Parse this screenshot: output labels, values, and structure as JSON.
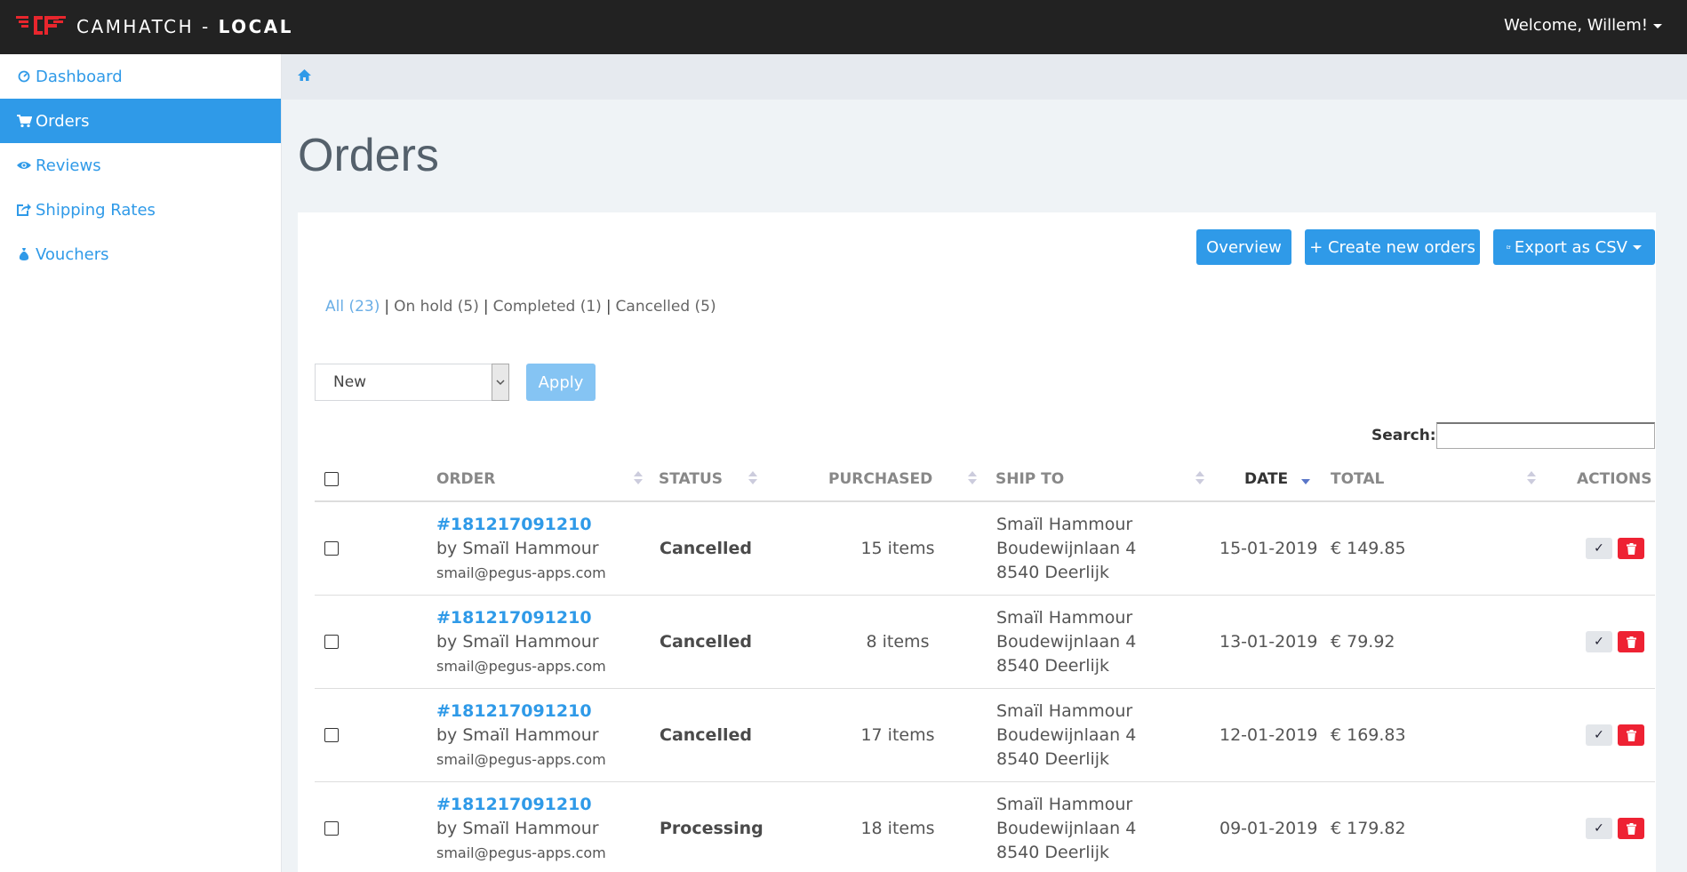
{
  "header": {
    "brand_name": "CAMHATCH - ",
    "brand_env": "LOCAL",
    "welcome": "Welcome, Willem!"
  },
  "sidebar": {
    "items": [
      {
        "label": "Dashboard",
        "icon": "dashboard-icon",
        "active": false
      },
      {
        "label": "Orders",
        "icon": "cart-icon",
        "active": true
      },
      {
        "label": "Reviews",
        "icon": "eye-icon",
        "active": false
      },
      {
        "label": "Shipping Rates",
        "icon": "share-icon",
        "active": false
      },
      {
        "label": "Vouchers",
        "icon": "money-bag-icon",
        "active": false
      }
    ]
  },
  "breadcrumb": {
    "icon": "home-icon"
  },
  "page": {
    "title": "Orders"
  },
  "toolbar": {
    "overview_label": "Overview",
    "create_label": "+ Create new orders",
    "export_label": "Export as CSV"
  },
  "filters": {
    "all": "All (23)",
    "on_hold": "On hold (5)",
    "completed": "Completed (1)",
    "cancelled": "Cancelled (5)",
    "separator": "|"
  },
  "bulk": {
    "selected": "New",
    "apply_label": "Apply"
  },
  "search": {
    "label": "Search:",
    "value": ""
  },
  "table": {
    "columns": {
      "order": "ORDER",
      "status": "STATUS",
      "purchased": "PURCHASED",
      "ship_to": "SHIP TO",
      "date": "DATE",
      "total": "TOTAL",
      "actions": "ACTIONS"
    },
    "rows": [
      {
        "order_id": "#181217091210",
        "by": "by Smaïl Hammour",
        "email": "smail@pegus-apps.com",
        "status": "Cancelled",
        "purchased": "15 items",
        "ship_name": "Smaïl Hammour",
        "ship_street": "Boudewijnlaan 4",
        "ship_city": "8540 Deerlijk",
        "date": "15-01-2019",
        "total": "€ 149.85"
      },
      {
        "order_id": "#181217091210",
        "by": "by Smaïl Hammour",
        "email": "smail@pegus-apps.com",
        "status": "Cancelled",
        "purchased": "8 items",
        "ship_name": "Smaïl Hammour",
        "ship_street": "Boudewijnlaan 4",
        "ship_city": "8540 Deerlijk",
        "date": "13-01-2019",
        "total": "€ 79.92"
      },
      {
        "order_id": "#181217091210",
        "by": "by Smaïl Hammour",
        "email": "smail@pegus-apps.com",
        "status": "Cancelled",
        "purchased": "17 items",
        "ship_name": "Smaïl Hammour",
        "ship_street": "Boudewijnlaan 4",
        "ship_city": "8540 Deerlijk",
        "date": "12-01-2019",
        "total": "€ 169.83"
      },
      {
        "order_id": "#181217091210",
        "by": "by Smaïl Hammour",
        "email": "smail@pegus-apps.com",
        "status": "Processing",
        "purchased": "18 items",
        "ship_name": "Smaïl Hammour",
        "ship_street": "Boudewijnlaan 4",
        "ship_city": "8540 Deerlijk",
        "date": "09-01-2019",
        "total": "€ 179.82"
      }
    ]
  },
  "colors": {
    "accent": "#2f9ae8",
    "topbar": "#222222",
    "logo": "#e8262d",
    "delete": "#ee2233"
  }
}
